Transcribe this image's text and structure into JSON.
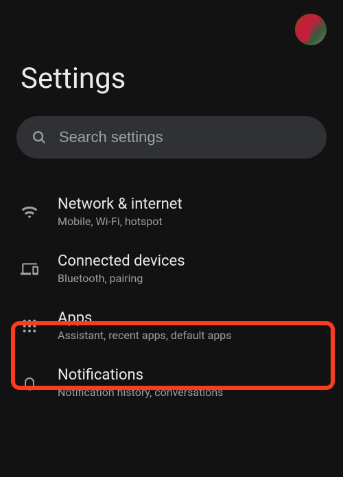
{
  "header": {
    "title": "Settings"
  },
  "search": {
    "placeholder": "Search settings"
  },
  "items": [
    {
      "label": "Network & internet",
      "desc": "Mobile, Wi-Fi, hotspot"
    },
    {
      "label": "Connected devices",
      "desc": "Bluetooth, pairing"
    },
    {
      "label": "Apps",
      "desc": "Assistant, recent apps, default apps"
    },
    {
      "label": "Notifications",
      "desc": "Notification history, conversations"
    }
  ]
}
